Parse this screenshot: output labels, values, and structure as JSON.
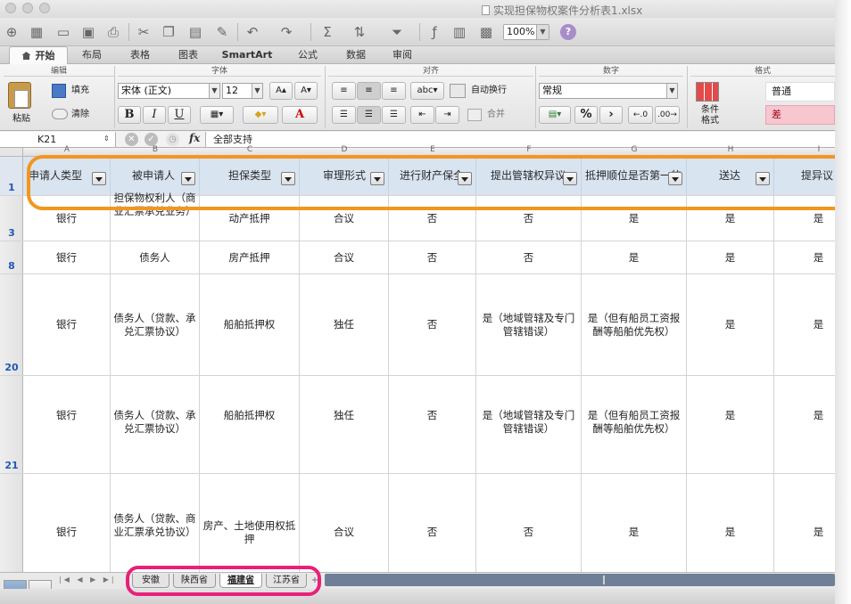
{
  "window": {
    "title": "实现担保物权案件分析表1.xlsx"
  },
  "toolbar": {
    "zoom": "100%"
  },
  "ribbon": {
    "tabs": [
      "开始",
      "布局",
      "表格",
      "图表",
      "SmartArt",
      "公式",
      "数据",
      "审阅"
    ],
    "groups": {
      "edit": "编辑",
      "font": "字体",
      "align": "对齐",
      "number": "数字",
      "format": "格式"
    },
    "paste_label": "粘贴",
    "fill_label": "填充",
    "clear_label": "清除",
    "font_name": "宋体 (正文)",
    "font_size": "12",
    "bold": "B",
    "italic": "I",
    "underline": "U",
    "font_color_letter": "A",
    "wrap_text": "自动换行",
    "merge": "合并",
    "abc_label": "abc",
    "number_format": "常规",
    "percent": "%",
    "comma": "⁾",
    "cond_format_line1": "条件",
    "cond_format_line2": "格式",
    "style_normal": "普通",
    "style_bad": "差"
  },
  "formula_bar": {
    "cell_ref": "K21",
    "fx": "fx",
    "content": "全部支持"
  },
  "columns": [
    "A",
    "B",
    "C",
    "D",
    "E",
    "F",
    "G",
    "H",
    "I"
  ],
  "header": {
    "row_num": "1",
    "cells": [
      "申请人类型",
      "被申请人",
      "担保类型",
      "审理形式",
      "进行财产保全",
      "提出管辖权异议",
      "抵押顺位是否第一的",
      "送达",
      "提异议"
    ]
  },
  "rows": [
    {
      "num": "3",
      "cells": [
        "银行",
        "担保物权利人（商业汇票承兑业务）",
        "动产抵押",
        "合议",
        "否",
        "否",
        "是",
        "是",
        "是"
      ]
    },
    {
      "num": "8",
      "cells": [
        "银行",
        "债务人",
        "房产抵押",
        "合议",
        "否",
        "否",
        "是",
        "是",
        "是"
      ]
    },
    {
      "num": "20",
      "cells": [
        "银行",
        "债务人（贷款、承兑汇票协议）",
        "船舶抵押权",
        "独任",
        "否",
        "是（地域管辖及专门管辖错误）",
        "是（但有船员工资报酬等船舶优先权）",
        "是",
        "是"
      ]
    },
    {
      "num": "21",
      "cells": [
        "银行",
        "债务人（贷款、承兑汇票协议）",
        "船舶抵押权",
        "独任",
        "否",
        "是（地域管辖及专门管辖错误）",
        "是（但有船员工资报酬等船舶优先权）",
        "是",
        "是"
      ]
    },
    {
      "num": "",
      "cells": [
        "银行",
        "债务人（贷款、商业汇票承兑协议）",
        "房产、土地使用权抵押",
        "合议",
        "否",
        "否",
        "是",
        "是",
        "是"
      ]
    }
  ],
  "sheets": {
    "tabs": [
      "安徽",
      "陕西省",
      "福建省",
      "江苏省"
    ],
    "active_index": 2
  },
  "annotation_colors": {
    "header_highlight": "#f3961f",
    "sheet_tabs_highlight": "#e8207a"
  }
}
